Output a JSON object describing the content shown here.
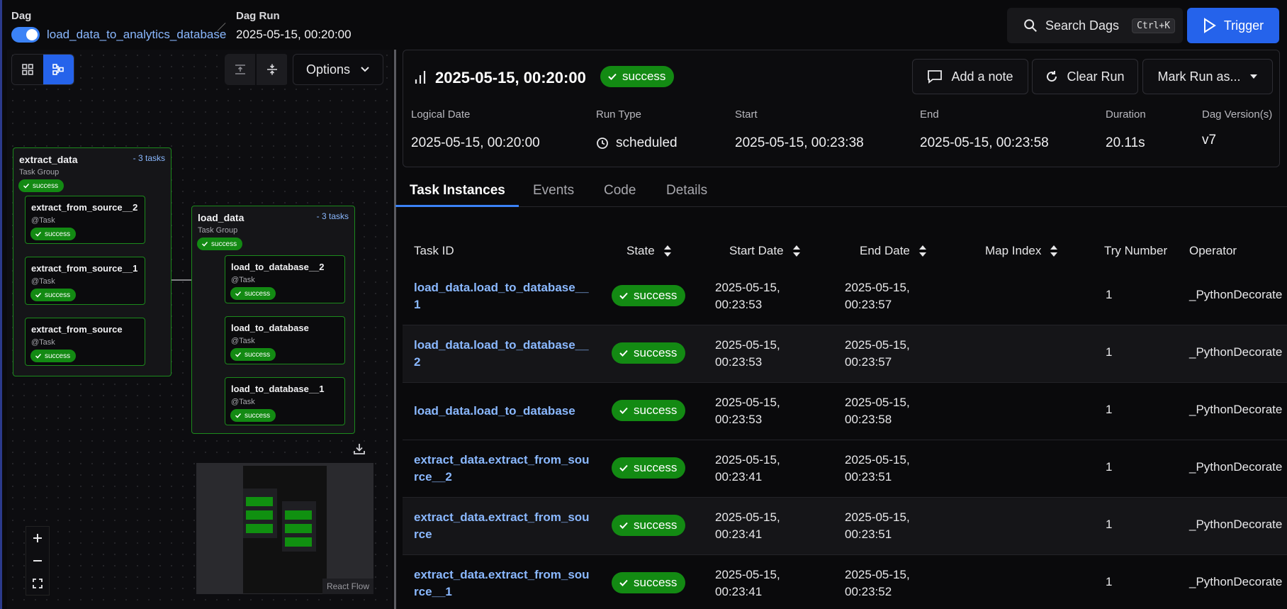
{
  "header": {
    "dag_label": "Dag",
    "dag_name": "load_data_to_analytics_database",
    "run_label": "Dag Run",
    "run_value": "2025-05-15, 00:20:00",
    "search_label": "Search Dags",
    "search_shortcut": "Ctrl+K",
    "trigger_label": "Trigger"
  },
  "graph": {
    "options_label": "Options",
    "react_flow_label": "React Flow",
    "groups": [
      {
        "title": "extract_data",
        "count": "- 3 tasks",
        "subtitle": "Task Group",
        "state": "success"
      },
      {
        "title": "load_data",
        "count": "- 3 tasks",
        "subtitle": "Task Group",
        "state": "success"
      }
    ],
    "nodes": [
      {
        "title": "extract_from_source__2",
        "subtitle": "@Task",
        "state": "success"
      },
      {
        "title": "extract_from_source__1",
        "subtitle": "@Task",
        "state": "success"
      },
      {
        "title": "extract_from_source",
        "subtitle": "@Task",
        "state": "success"
      },
      {
        "title": "load_to_database__2",
        "subtitle": "@Task",
        "state": "success"
      },
      {
        "title": "load_to_database",
        "subtitle": "@Task",
        "state": "success"
      },
      {
        "title": "load_to_database__1",
        "subtitle": "@Task",
        "state": "success"
      }
    ]
  },
  "run": {
    "title": "2025-05-15, 00:20:00",
    "state": "success",
    "add_note": "Add a note",
    "clear_run": "Clear Run",
    "mark_run": "Mark Run as...",
    "meta": [
      {
        "label": "Logical Date",
        "value": "2025-05-15, 00:20:00"
      },
      {
        "label": "Run Type",
        "value": "scheduled"
      },
      {
        "label": "Start",
        "value": "2025-05-15, 00:23:38"
      },
      {
        "label": "End",
        "value": "2025-05-15, 00:23:58"
      },
      {
        "label": "Duration",
        "value": "20.11s"
      },
      {
        "label": "Dag Version(s)",
        "value": "v7"
      }
    ]
  },
  "tabs": [
    "Task Instances",
    "Events",
    "Code",
    "Details"
  ],
  "table": {
    "columns": [
      "Task ID",
      "State",
      "Start Date",
      "End Date",
      "Map Index",
      "Try Number",
      "Operator"
    ],
    "rows": [
      {
        "id1": "load_data.load_to_database__",
        "id2": "1",
        "state": "success",
        "start1": "2025-05-15,",
        "start2": "00:23:53",
        "end1": "2025-05-15,",
        "end2": "00:23:57",
        "try": "1",
        "operator": "_PythonDecorate"
      },
      {
        "id1": "load_data.load_to_database__",
        "id2": "2",
        "state": "success",
        "start1": "2025-05-15,",
        "start2": "00:23:53",
        "end1": "2025-05-15,",
        "end2": "00:23:57",
        "try": "1",
        "operator": "_PythonDecorate"
      },
      {
        "id1": "load_data.load_to_database",
        "id2": "",
        "state": "success",
        "start1": "2025-05-15,",
        "start2": "00:23:53",
        "end1": "2025-05-15,",
        "end2": "00:23:58",
        "try": "1",
        "operator": "_PythonDecorate"
      },
      {
        "id1": "extract_data.extract_from_sou",
        "id2": "rce__2",
        "state": "success",
        "start1": "2025-05-15,",
        "start2": "00:23:41",
        "end1": "2025-05-15,",
        "end2": "00:23:51",
        "try": "1",
        "operator": "_PythonDecorate"
      },
      {
        "id1": "extract_data.extract_from_sou",
        "id2": "rce",
        "state": "success",
        "start1": "2025-05-15,",
        "start2": "00:23:41",
        "end1": "2025-05-15,",
        "end2": "00:23:51",
        "try": "1",
        "operator": "_PythonDecorate"
      },
      {
        "id1": "extract_data.extract_from_sou",
        "id2": "rce__1",
        "state": "success",
        "start1": "2025-05-15,",
        "start2": "00:23:41",
        "end1": "2025-05-15,",
        "end2": "00:23:52",
        "try": "1",
        "operator": "_PythonDecorate"
      }
    ]
  },
  "colors": {
    "accent": "#2563eb",
    "success": "#138a13",
    "link": "#8ab8ff"
  }
}
